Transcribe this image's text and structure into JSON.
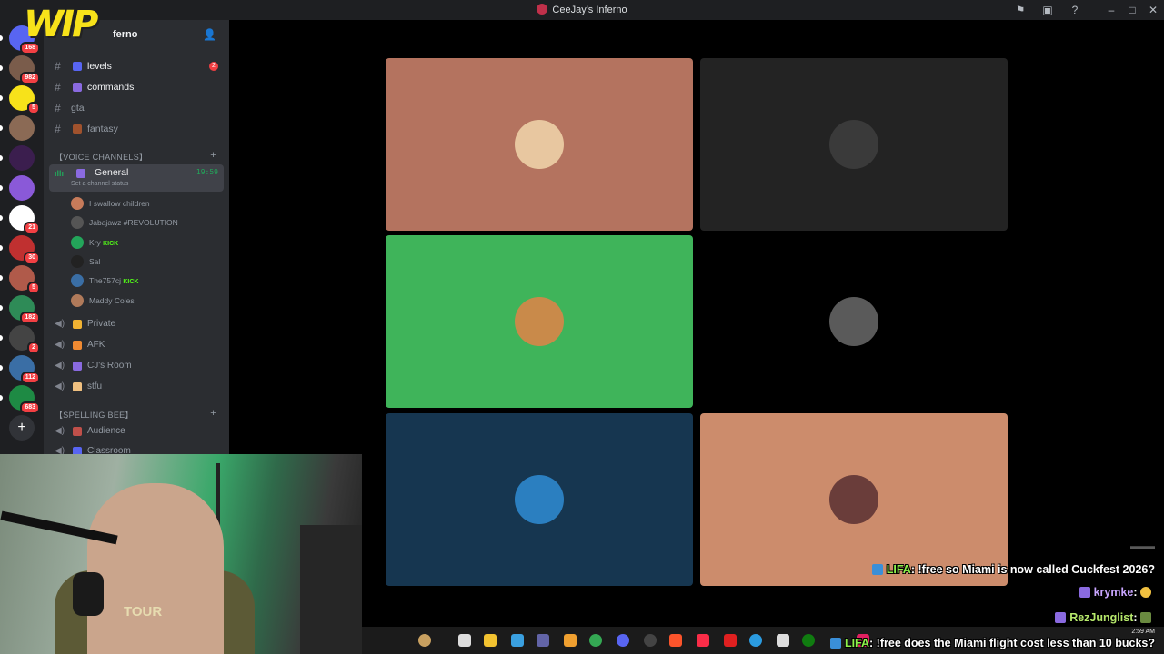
{
  "window": {
    "title": "CeeJay's Inferno",
    "controls": [
      "minimize-icon",
      "maximize-icon",
      "close-icon"
    ]
  },
  "overlay": {
    "logo_text": "WIP"
  },
  "rail": {
    "servers": [
      {
        "badge": "168",
        "color": "#5865f2"
      },
      {
        "badge": "982",
        "color": "#7a5c4b"
      },
      {
        "badge": "5",
        "color": "#f7e21a"
      },
      {
        "badge": "",
        "color": "#8b6a55"
      },
      {
        "badge": "",
        "color": "#3b1e4e"
      },
      {
        "badge": "",
        "color": "#8a59d8"
      },
      {
        "badge": "21",
        "color": "#ffffff"
      },
      {
        "badge": "30",
        "color": "#c03030"
      },
      {
        "badge": "5",
        "color": "#b05a4a"
      },
      {
        "badge": "182",
        "color": "#2e8b57"
      },
      {
        "badge": "2",
        "color": "#444444"
      },
      {
        "badge": "112",
        "color": "#3a6ea5"
      },
      {
        "badge": "683",
        "color": "#1e8a44"
      }
    ]
  },
  "guild": {
    "name": "ferno"
  },
  "channels": {
    "text": [
      {
        "label": "levels",
        "emoji_color": "#5865f2",
        "mention": "2"
      },
      {
        "label": "commands",
        "emoji_color": "#8a6ae0",
        "mention": ""
      },
      {
        "label": "gta",
        "emoji_color": "",
        "mention": ""
      },
      {
        "label": "fantasy",
        "emoji_color": "#a0522d",
        "mention": ""
      }
    ],
    "voice_category": "【VOICE CHANNELS】",
    "active_voice": {
      "label": "General",
      "time": "19:59",
      "status": "Set a channel status"
    },
    "voice_users": [
      {
        "name": "I swallow children",
        "color": "#c77b5a",
        "tag": ""
      },
      {
        "name": "Jabajawz #REVOLUTION",
        "color": "#555555",
        "tag": ""
      },
      {
        "name": "Kry",
        "color": "#23a55a",
        "tag": "KICK"
      },
      {
        "name": "Sal",
        "color": "#222222",
        "tag": ""
      },
      {
        "name": "The757cj",
        "color": "#3a6ea5",
        "tag": "KICK"
      },
      {
        "name": "Maddy Coles",
        "color": "#b07a5a",
        "tag": ""
      }
    ],
    "voice_channels": [
      {
        "label": "Private",
        "emoji_color": "#f0b232"
      },
      {
        "label": "AFK",
        "emoji_color": "#f08a32"
      },
      {
        "label": "CJ's Room",
        "emoji_color": "#8a6ae0"
      },
      {
        "label": "stfu",
        "emoji_color": "#f0c080"
      }
    ],
    "spelling_category": "【SPELLING BEE】",
    "spelling_channels": [
      {
        "label": "Audience",
        "emoji_color": "#c0504a"
      },
      {
        "label": "Classroom",
        "emoji_color": "#5865f2"
      }
    ]
  },
  "call": {
    "tiles": [
      {
        "bg": "#b4735f",
        "avatar": "#e8c7a0"
      },
      {
        "bg": "#232323",
        "avatar": "#3a3a3a"
      },
      {
        "bg": "#3fb45a",
        "avatar": "#c98a4a"
      },
      {
        "bg": "#000000",
        "avatar": "#5a5a5a"
      },
      {
        "bg": "#163650",
        "avatar": "#2b7fc0"
      },
      {
        "bg": "#cc8c6c",
        "avatar": "#6a3d3a"
      }
    ]
  },
  "webcam": {
    "shirt_text": "TOUR"
  },
  "taskbar": {
    "time": "2:59 AM"
  },
  "chat": {
    "messages": [
      {
        "user": "LIFA",
        "text": "!free so Miami is now called Cuckfest 2026?",
        "icon_color": "#3a8fd8"
      },
      {
        "user": "krymke",
        "text": "",
        "icon_color": "#8a6ae0"
      },
      {
        "user": "RezJunglist",
        "text": "",
        "icon_color": "#8a6ae0"
      },
      {
        "user": "LIFA",
        "text": "!free does the Miami flight cost less than 10 bucks?",
        "icon_color": "#3a8fd8"
      }
    ]
  }
}
